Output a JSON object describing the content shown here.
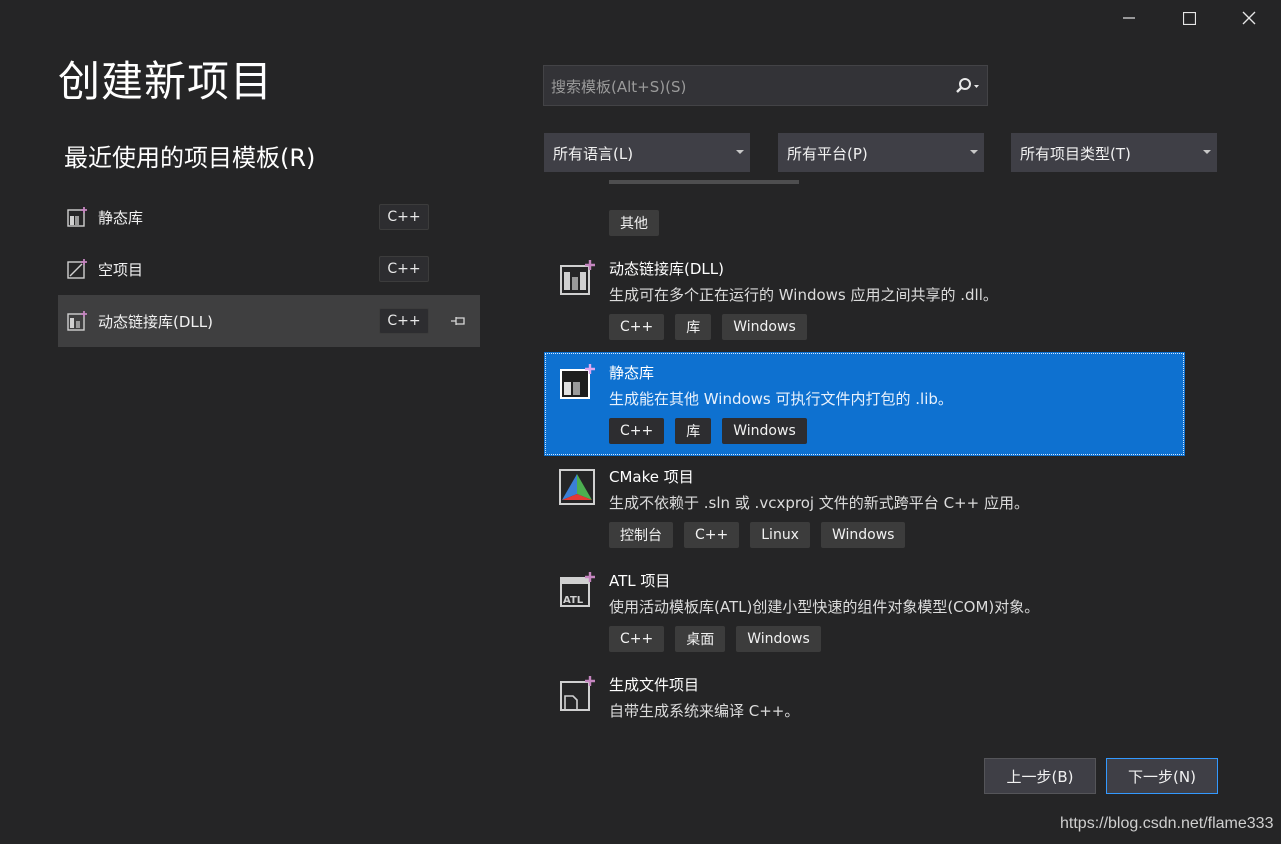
{
  "window": {
    "controls": [
      "minimize-icon",
      "maximize-icon",
      "close-icon"
    ]
  },
  "page": {
    "title": "创建新项目",
    "recent_title": "最近使用的项目模板(R)"
  },
  "recent": [
    {
      "label": "静态库",
      "badge": "C++",
      "icon": "static-library-icon",
      "selected": false
    },
    {
      "label": "空项目",
      "badge": "C++",
      "icon": "empty-project-icon",
      "selected": false
    },
    {
      "label": "动态链接库(DLL)",
      "badge": "C++",
      "icon": "dll-icon",
      "selected": true,
      "pinned": true
    }
  ],
  "search": {
    "placeholder": "搜索模板(Alt+S)(S)"
  },
  "filters": {
    "language": "所有语言(L)",
    "platform": "所有平台(P)",
    "project_type": "所有项目类型(T)"
  },
  "templates": {
    "partial_tags": [
      "其他"
    ],
    "items": [
      {
        "name": "动态链接库(DLL)",
        "desc": "生成可在多个正在运行的 Windows 应用之间共享的 .dll。",
        "tags": [
          "C++",
          "库",
          "Windows"
        ],
        "icon": "dll-icon",
        "selected": false
      },
      {
        "name": "静态库",
        "desc": "生成能在其他 Windows 可执行文件内打包的 .lib。",
        "tags": [
          "C++",
          "库",
          "Windows"
        ],
        "icon": "static-library-icon",
        "selected": true
      },
      {
        "name": "CMake 项目",
        "desc": "生成不依赖于 .sln 或 .vcxproj 文件的新式跨平台 C++ 应用。",
        "tags": [
          "控制台",
          "C++",
          "Linux",
          "Windows"
        ],
        "icon": "cmake-icon",
        "selected": false
      },
      {
        "name": "ATL 项目",
        "desc": "使用活动模板库(ATL)创建小型快速的组件对象模型(COM)对象。",
        "tags": [
          "C++",
          "桌面",
          "Windows"
        ],
        "icon": "atl-icon",
        "selected": false
      },
      {
        "name": "生成文件项目",
        "desc": "自带生成系统来编译 C++。",
        "tags": [],
        "icon": "makefile-project-icon",
        "selected": false
      }
    ]
  },
  "buttons": {
    "back": "上一步(B)",
    "next": "下一步(N)"
  },
  "watermark": "https://blog.csdn.net/flame333",
  "colors": {
    "background": "#252526",
    "selection": "#0e71d0",
    "accent_border": "#3399ff"
  }
}
